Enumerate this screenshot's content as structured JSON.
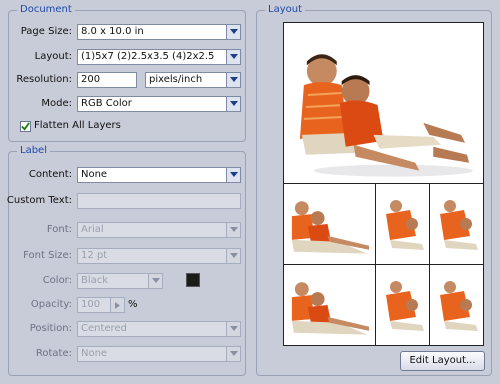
{
  "document": {
    "title": "Document",
    "page_size": {
      "label": "Page Size:",
      "value": "8.0 x 10.0 in"
    },
    "layout": {
      "label": "Layout:",
      "value": "(1)5x7 (2)2.5x3.5 (4)2x2.5"
    },
    "resolution": {
      "label": "Resolution:",
      "value": "200",
      "unit": "pixels/inch"
    },
    "mode": {
      "label": "Mode:",
      "value": "RGB Color"
    },
    "flatten": {
      "label": "Flatten All Layers",
      "checked": true
    }
  },
  "label": {
    "title": "Label",
    "content": {
      "label": "Content:",
      "value": "None"
    },
    "custom_text": {
      "label": "Custom Text:",
      "value": ""
    },
    "font": {
      "label": "Font:",
      "value": "Arial"
    },
    "font_size": {
      "label": "Font Size:",
      "value": "12 pt"
    },
    "color": {
      "label": "Color:",
      "value": "Black",
      "swatch": "#1b1b1b"
    },
    "opacity": {
      "label": "Opacity:",
      "value": "100",
      "unit": "%"
    },
    "position": {
      "label": "Position:",
      "value": "Centered"
    },
    "rotate": {
      "label": "Rotate:",
      "value": "None"
    }
  },
  "layout_panel": {
    "title": "Layout",
    "edit_button": "Edit Layout..."
  },
  "colors": {
    "accent": "#1f4aa8",
    "panel_bg": "#c8ccd8"
  }
}
